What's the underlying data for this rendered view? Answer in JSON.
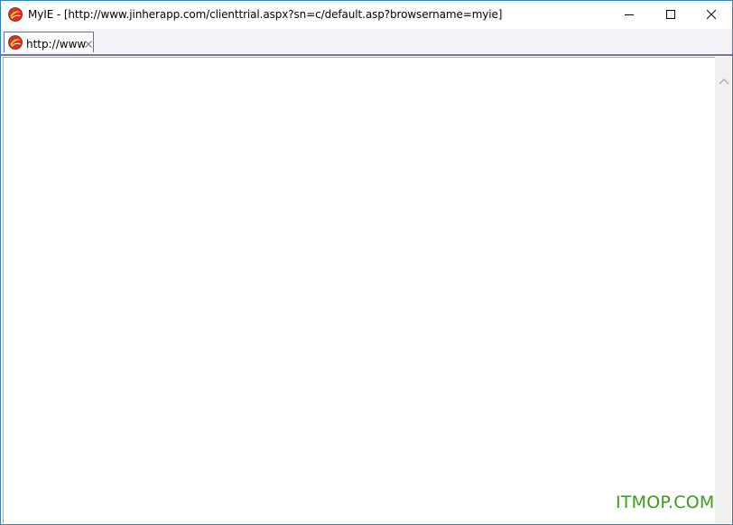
{
  "window": {
    "title": "MyIE - [http://www.jinherapp.com/clienttrial.aspx?sn=c/default.asp?browsername=myie]",
    "app_icon": "myie-logo-icon",
    "controls": {
      "minimize_icon": "minimize-icon",
      "maximize_icon": "maximize-icon",
      "close_icon": "close-icon"
    }
  },
  "tabs": [
    {
      "label": "http://www",
      "icon": "myie-logo-icon",
      "close_icon": "tab-close-icon",
      "active": true
    }
  ],
  "watermark": "ITMOP.COM",
  "colors": {
    "window_border": "#3c7fb1",
    "tab_strip_bg": "#f4f4f8",
    "tab_border": "#6a6ea8",
    "tab_strip_line": "#7474a6",
    "watermark": "#3d9a1e",
    "scrollbar_bg": "#f0f0f0"
  }
}
